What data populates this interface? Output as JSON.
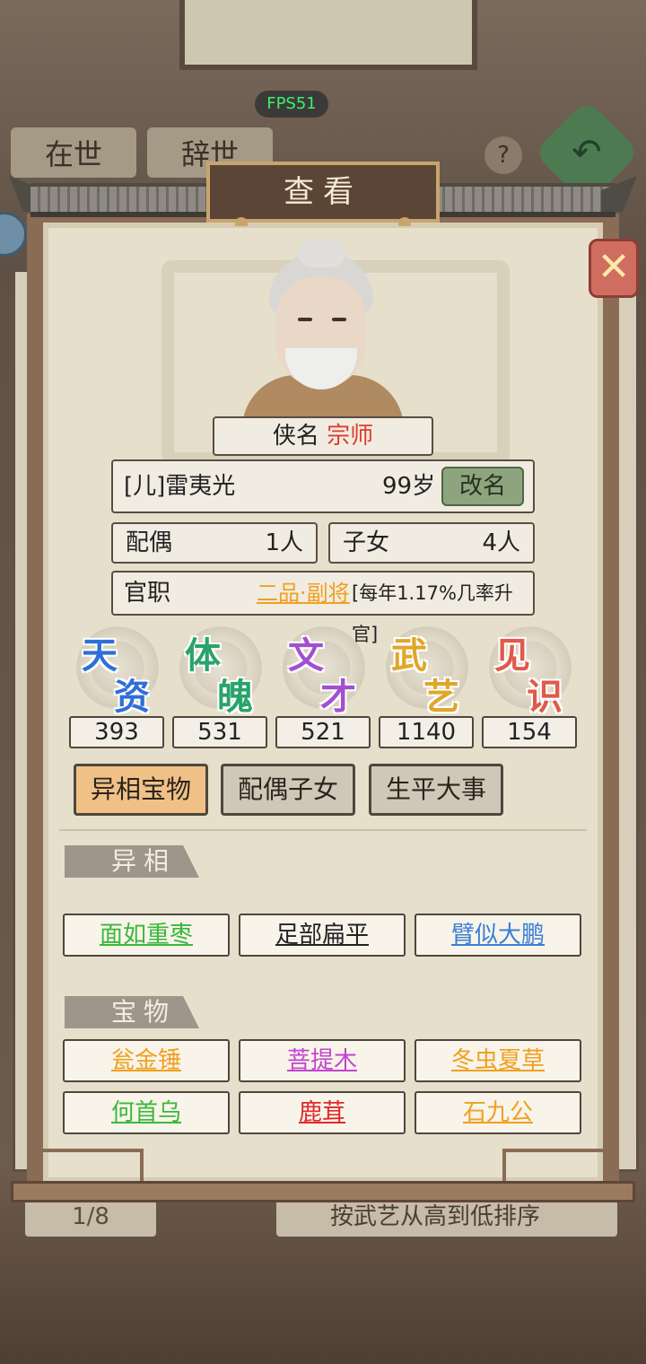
{
  "background": {
    "tab_alive": "在世",
    "tab_dead": "辞世",
    "fps": "FPS51",
    "help_icon": "question-icon",
    "back_icon": "back-arrow-icon",
    "page_indicator": "1/8",
    "sort_label": "按武艺从高到低排序"
  },
  "dialog": {
    "title": "查看",
    "close_icon": "close-icon",
    "title_label": "侠名",
    "title_value": "宗师",
    "name": "[儿]雷夷光",
    "age": "99岁",
    "rename_label": "改名",
    "spouse_label": "配偶",
    "spouse_value": "1人",
    "children_label": "子女",
    "children_value": "4人",
    "office_label": "官职",
    "office_rank": "二品·副将",
    "office_note": "[每年1.17%几率升官]"
  },
  "attributes": [
    {
      "c1": "天",
      "c2": "资",
      "value": "393",
      "color": "#2f6fd6"
    },
    {
      "c1": "体",
      "c2": "魄",
      "value": "531",
      "color": "#2aa36b"
    },
    {
      "c1": "文",
      "c2": "才",
      "value": "521",
      "color": "#a24fd1"
    },
    {
      "c1": "武",
      "c2": "艺",
      "value": "1140",
      "color": "#e0a62a"
    },
    {
      "c1": "见",
      "c2": "识",
      "value": "154",
      "color": "#e05a4a"
    }
  ],
  "tabs": [
    {
      "label": "异相宝物",
      "active": true
    },
    {
      "label": "配偶子女",
      "active": false
    },
    {
      "label": "生平大事",
      "active": false
    }
  ],
  "traits_section": {
    "label": "异相",
    "items": [
      {
        "label": "面如重枣",
        "color": "#3bb83b"
      },
      {
        "label": "足部扁平",
        "color": "#222222"
      },
      {
        "label": "臂似大鹏",
        "color": "#3a7fd6"
      }
    ]
  },
  "treasure_section": {
    "label": "宝物",
    "items": [
      {
        "label": "瓮金锤",
        "color": "#f0a020"
      },
      {
        "label": "菩提木",
        "color": "#c244cf"
      },
      {
        "label": "冬虫夏草",
        "color": "#f0a020"
      },
      {
        "label": "何首乌",
        "color": "#3bb83b"
      },
      {
        "label": "鹿茸",
        "color": "#e02a2a"
      },
      {
        "label": "石九公",
        "color": "#f0a020"
      }
    ]
  }
}
